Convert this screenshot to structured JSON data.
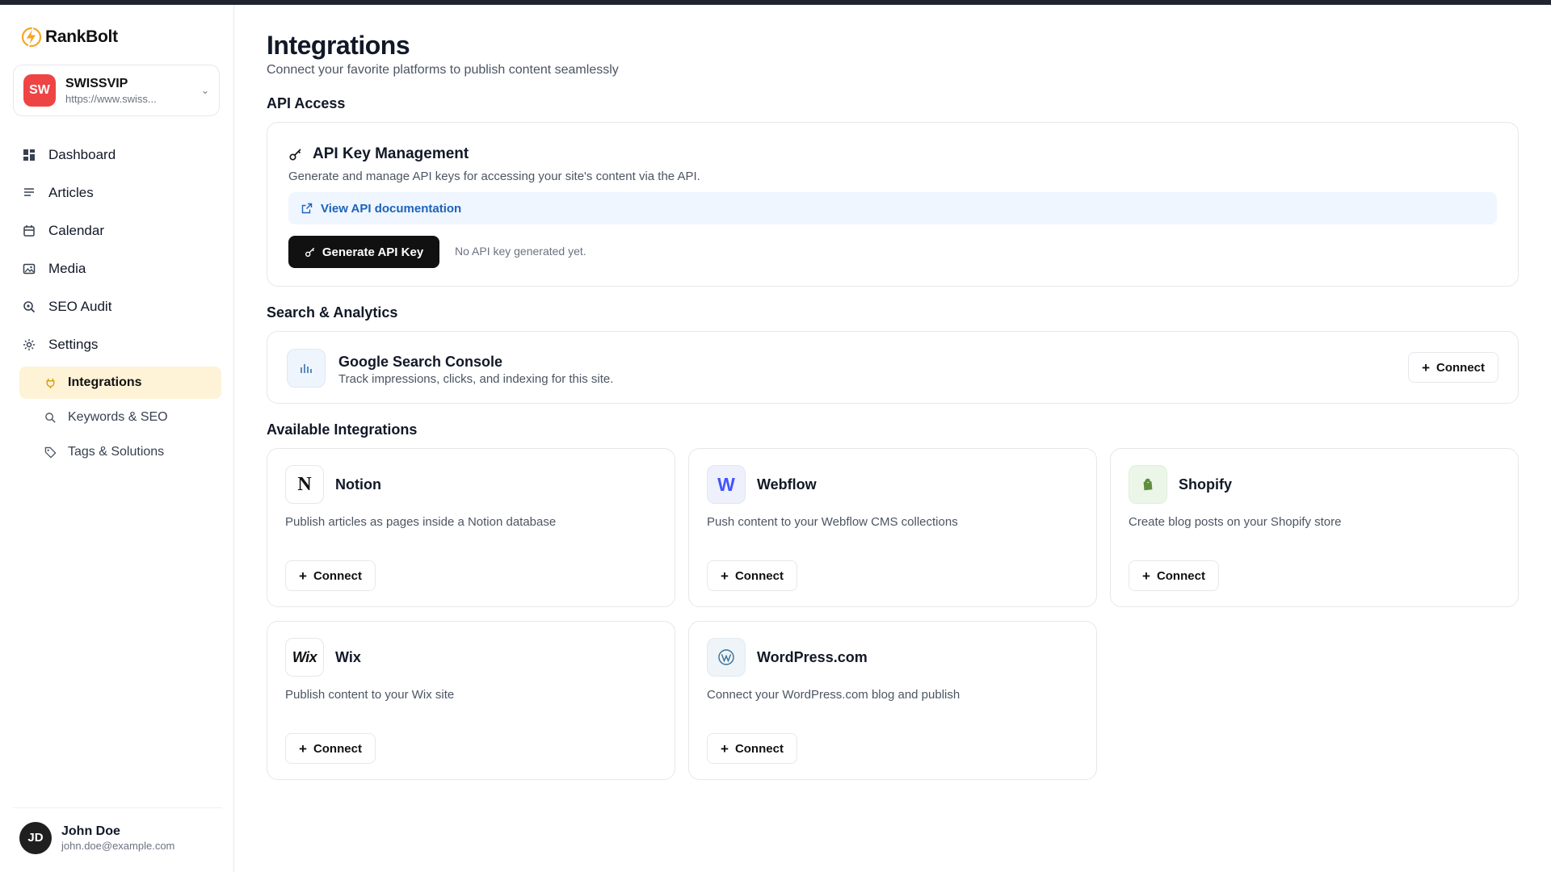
{
  "app": {
    "name": "RankBolt"
  },
  "site": {
    "initials": "SW",
    "name": "SWISSVIP",
    "url": "https://www.swiss..."
  },
  "nav": {
    "dashboard": "Dashboard",
    "articles": "Articles",
    "calendar": "Calendar",
    "media": "Media",
    "seo_audit": "SEO Audit",
    "settings": "Settings",
    "sub": {
      "integrations": "Integrations",
      "keywords": "Keywords & SEO",
      "tags": "Tags & Solutions"
    }
  },
  "user": {
    "initials": "JD",
    "name": "John Doe",
    "email": "john.doe@example.com"
  },
  "page": {
    "title": "Integrations",
    "subtitle": "Connect your favorite platforms to publish content seamlessly"
  },
  "api": {
    "section": "API Access",
    "title": "API Key Management",
    "description": "Generate and manage API keys for accessing your site's content via the API.",
    "doc_link": "View API documentation",
    "generate_label": "Generate API Key",
    "status": "No API key generated yet."
  },
  "search": {
    "section": "Search & Analytics",
    "gsc": {
      "title": "Google Search Console",
      "description": "Track impressions, clicks, and indexing for this site.",
      "connect": "Connect"
    }
  },
  "integrations": {
    "section": "Available Integrations",
    "connect_label": "Connect",
    "items": [
      {
        "name": "Notion",
        "description": "Publish articles as pages inside a Notion database",
        "icon": "notion-icon",
        "glyph": "N"
      },
      {
        "name": "Webflow",
        "description": "Push content to your Webflow CMS collections",
        "icon": "webflow-icon",
        "glyph": "W"
      },
      {
        "name": "Shopify",
        "description": "Create blog posts on your Shopify store",
        "icon": "shopify-icon"
      },
      {
        "name": "Wix",
        "description": "Publish content to your Wix site",
        "icon": "wix-icon",
        "glyph": "Wix"
      },
      {
        "name": "WordPress.com",
        "description": "Connect your WordPress.com blog and publish",
        "icon": "wordpress-icon"
      }
    ]
  },
  "colors": {
    "accent_active_bg": "#fef3d7",
    "link_blue": "#1d63b8",
    "site_avatar": "#ef4444",
    "logo_bolt": "#f5a623"
  }
}
